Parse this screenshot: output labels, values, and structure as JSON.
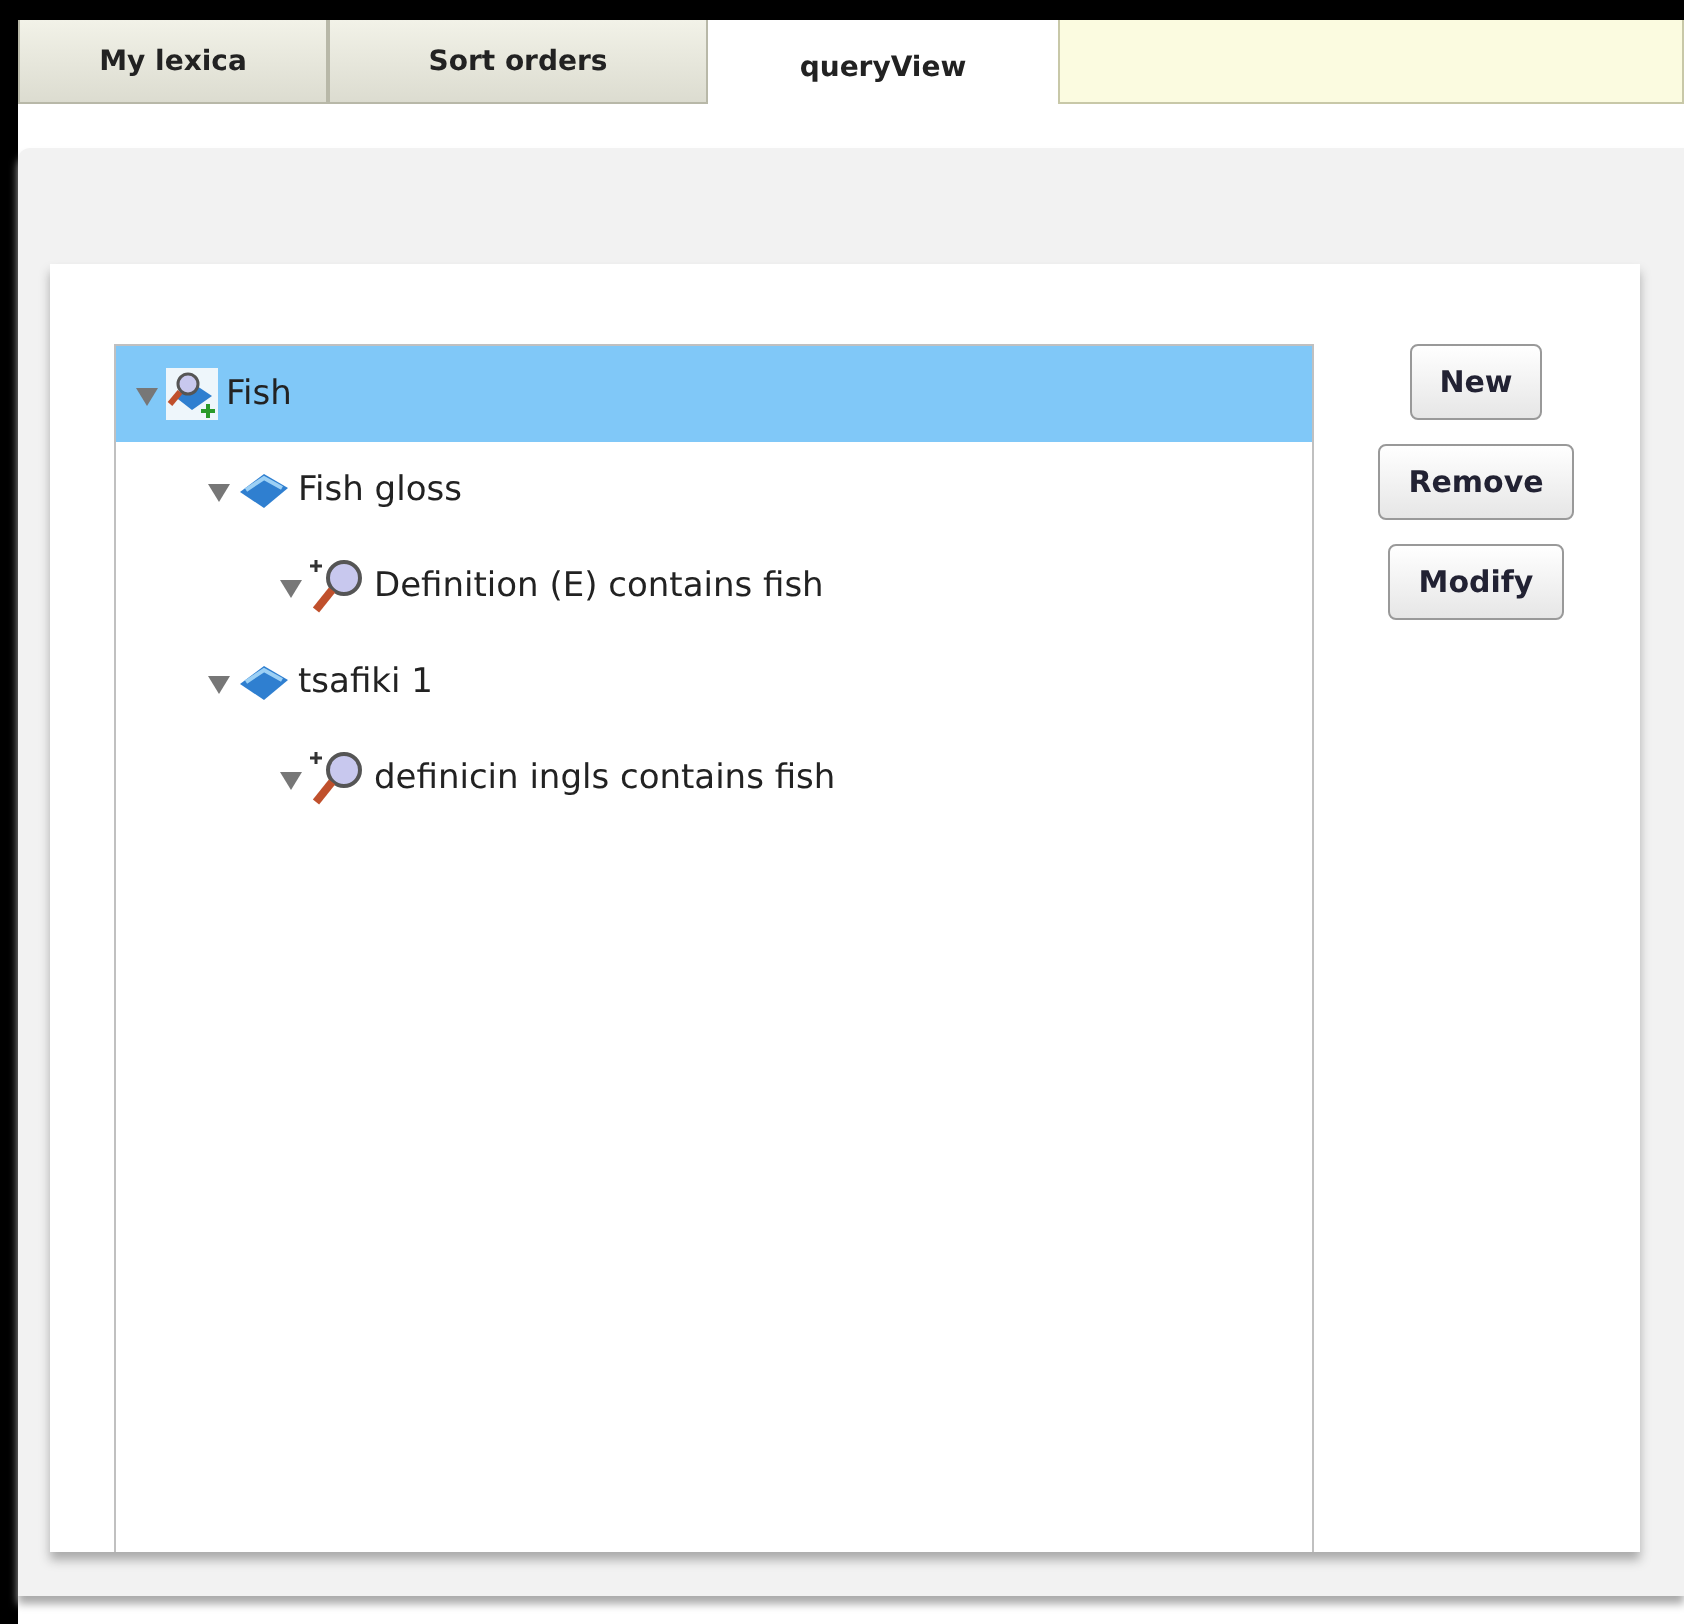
{
  "tabs": [
    {
      "label": "My lexica",
      "selected": false
    },
    {
      "label": "Sort orders",
      "selected": false
    },
    {
      "label": "queryView",
      "selected": true
    }
  ],
  "tree": [
    {
      "label": "Fish",
      "kind": "query",
      "expanded": true,
      "selected": true,
      "children": [
        {
          "label": "Fish gloss",
          "kind": "lexicon",
          "expanded": true,
          "selected": false,
          "children": [
            {
              "label": "Definition (E) contains fish",
              "kind": "condition",
              "expanded": true,
              "selected": false
            }
          ]
        },
        {
          "label": "tsafiki 1",
          "kind": "lexicon",
          "expanded": true,
          "selected": false,
          "children": [
            {
              "label": "definicin ingls contains fish",
              "kind": "condition",
              "expanded": true,
              "selected": false
            }
          ]
        }
      ]
    }
  ],
  "buttons": [
    "New",
    "Remove",
    "Modify"
  ]
}
